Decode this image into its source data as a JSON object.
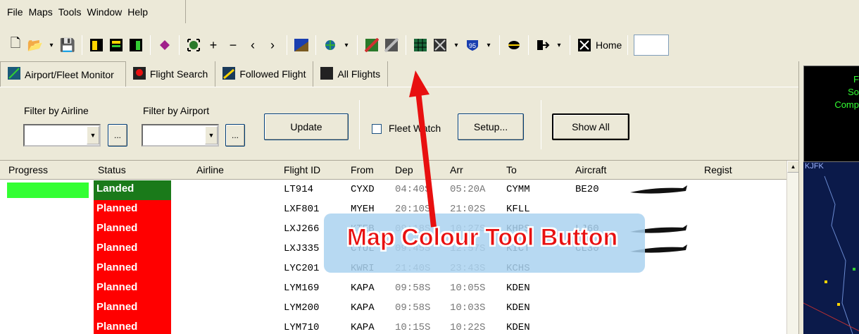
{
  "menu": {
    "file": "File",
    "maps": "Maps",
    "tools": "Tools",
    "window": "Window",
    "help": "Help"
  },
  "toolbar": {
    "home_label": "Home",
    "icons": [
      "new-icon",
      "open-icon",
      "save-icon",
      "panel-1-icon",
      "panel-2-icon",
      "panel-3-icon",
      "book-icon",
      "zoom-fit-icon",
      "zoom-in-icon",
      "zoom-out-icon",
      "back-icon",
      "forward-icon",
      "map-colour-icon",
      "weather-icon",
      "map-layer-1-icon",
      "map-layer-2-icon",
      "grid-icon",
      "chart-icon",
      "highway-icon",
      "globe-icon",
      "exit-icon",
      "home-icon"
    ],
    "zoom_in": "+",
    "zoom_out": "−",
    "back": "‹",
    "forward": "›",
    "highway": "95"
  },
  "tabs": [
    {
      "label": "Airport/Fleet Monitor"
    },
    {
      "label": "Flight Search"
    },
    {
      "label": "Followed Flight"
    },
    {
      "label": "All Flights"
    }
  ],
  "filters": {
    "airline_label": "Filter by Airline",
    "airport_label": "Filter by Airport",
    "ellipsis": "...",
    "update": "Update",
    "fleet_watch": "Fleet Watch",
    "setup": "Setup...",
    "show_all": "Show All"
  },
  "grid": {
    "columns": [
      "Progress",
      "Status",
      "Airline",
      "Flight ID",
      "From",
      "Dep",
      "Arr",
      "To",
      "Aircraft",
      "Regist"
    ],
    "rows": [
      {
        "status": "Landed",
        "flight": "LT914",
        "from": "CYXD",
        "dep": "04:40S",
        "arr": "05:20A",
        "to": "CYMM",
        "aircraft": "BE20"
      },
      {
        "status": "Planned",
        "flight": "LXF801",
        "from": "MYEH",
        "dep": "20:10S",
        "arr": "21:02S",
        "to": "KFLL",
        "aircraft": ""
      },
      {
        "status": "Planned",
        "flight": "LXJ266",
        "from": "KTEB",
        "dep": "09:18S",
        "arr": "10:27S",
        "to": "KHPS",
        "aircraft": "LJ60"
      },
      {
        "status": "Planned",
        "flight": "LXJ335",
        "from": "CYUL",
        "dep": "09:45S",
        "arr": "12:57S",
        "to": "KICT",
        "aircraft": "CL30"
      },
      {
        "status": "Planned",
        "flight": "LYC201",
        "from": "KWRI",
        "dep": "21:40S",
        "arr": "23:43S",
        "to": "KCHS",
        "aircraft": ""
      },
      {
        "status": "Planned",
        "flight": "LYM169",
        "from": "KAPA",
        "dep": "09:58S",
        "arr": "10:05S",
        "to": "KDEN",
        "aircraft": ""
      },
      {
        "status": "Planned",
        "flight": "LYM200",
        "from": "KAPA",
        "dep": "09:58S",
        "arr": "10:03S",
        "to": "KDEN",
        "aircraft": ""
      },
      {
        "status": "Planned",
        "flight": "LYM710",
        "from": "KAPA",
        "dep": "10:15S",
        "arr": "10:22S",
        "to": "KDEN",
        "aircraft": ""
      }
    ]
  },
  "right": {
    "line1": "F",
    "line2": "So",
    "line3": "Comp",
    "map_label": "KJFK"
  },
  "callout": {
    "text": "Map Colour Tool Button"
  },
  "colors": {
    "landed": "#1a7a1a",
    "planned": "#ff0000",
    "progress": "#33ff33",
    "arrow": "#e81010"
  }
}
